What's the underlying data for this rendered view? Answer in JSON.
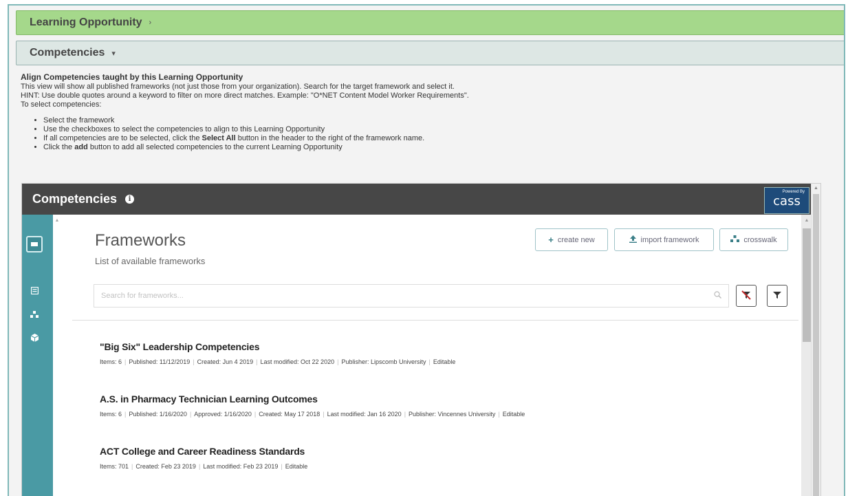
{
  "accordion": {
    "learning_opportunity": "Learning Opportunity",
    "learning_opportunity_caret": "›",
    "competencies": "Competencies",
    "competencies_caret": "▾"
  },
  "instructions": {
    "heading": "Align Competencies taught by this Learning Opportunity",
    "line1": "This view will show all published frameworks (not just those from your organization). Search for the target framework and select it.",
    "line2": "HINT: Use double quotes around a keyword to filter on more direct matches. Example: \"O*NET Content Model Worker Requirements\".",
    "line3": "To select competencies:",
    "bullet1": "Select the framework",
    "bullet2": "Use the checkboxes to select the competencies to align to this Learning Opportunity",
    "bullet3_pre": "If all competencies are to be selected, click the ",
    "bullet3_bold": "Select All",
    "bullet3_post": " button in the header to the right of the framework name.",
    "bullet4_pre": "Click the ",
    "bullet4_bold": "add",
    "bullet4_post": " button to add all selected competencies to the current Learning Opportunity"
  },
  "panel": {
    "title": "Competencies",
    "info_icon": "i",
    "logo_powered": "Powered By",
    "logo_name": "cass"
  },
  "frameworks": {
    "title": "Frameworks",
    "subtitle": "List of available frameworks",
    "create_label": "create new",
    "import_label": "import framework",
    "crosswalk_label": "crosswalk",
    "search_placeholder": "Search for frameworks...",
    "items": [
      {
        "name": "\"Big Six\" Leadership Competencies",
        "meta": [
          "Items: 6",
          "Published: 11/12/2019",
          "Created: Jun 4 2019",
          "Last modified: Oct 22 2020",
          "Publisher: Lipscomb University",
          "Editable"
        ]
      },
      {
        "name": "A.S. in Pharmacy Technician Learning Outcomes",
        "meta": [
          "Items: 6",
          "Published: 1/16/2020",
          "Approved: 1/16/2020",
          "Created: May 17 2018",
          "Last modified: Jan 16 2020",
          "Publisher: Vincennes University",
          "Editable"
        ]
      },
      {
        "name": "ACT College and Career Readiness Standards",
        "meta": [
          "Items: 701",
          "Created: Feb 23 2019",
          "Last modified: Feb 23 2019",
          "Editable"
        ]
      }
    ]
  },
  "icons": {
    "menu": "menu-icon",
    "list": "list-icon",
    "hierarchy": "hierarchy-icon",
    "cube": "cube-icon",
    "plus": "plus-icon",
    "upload": "upload-icon",
    "crosswalk": "crosswalk-icon",
    "search": "search-icon",
    "clear_filter": "clear-filter-icon",
    "filter": "filter-icon"
  },
  "colors": {
    "lo_header": "#a5d88b",
    "comp_header": "#dde7e4",
    "panel_bar": "#474747",
    "sidebar": "#4a9aa4",
    "accent_border": "#9fc3c8"
  }
}
